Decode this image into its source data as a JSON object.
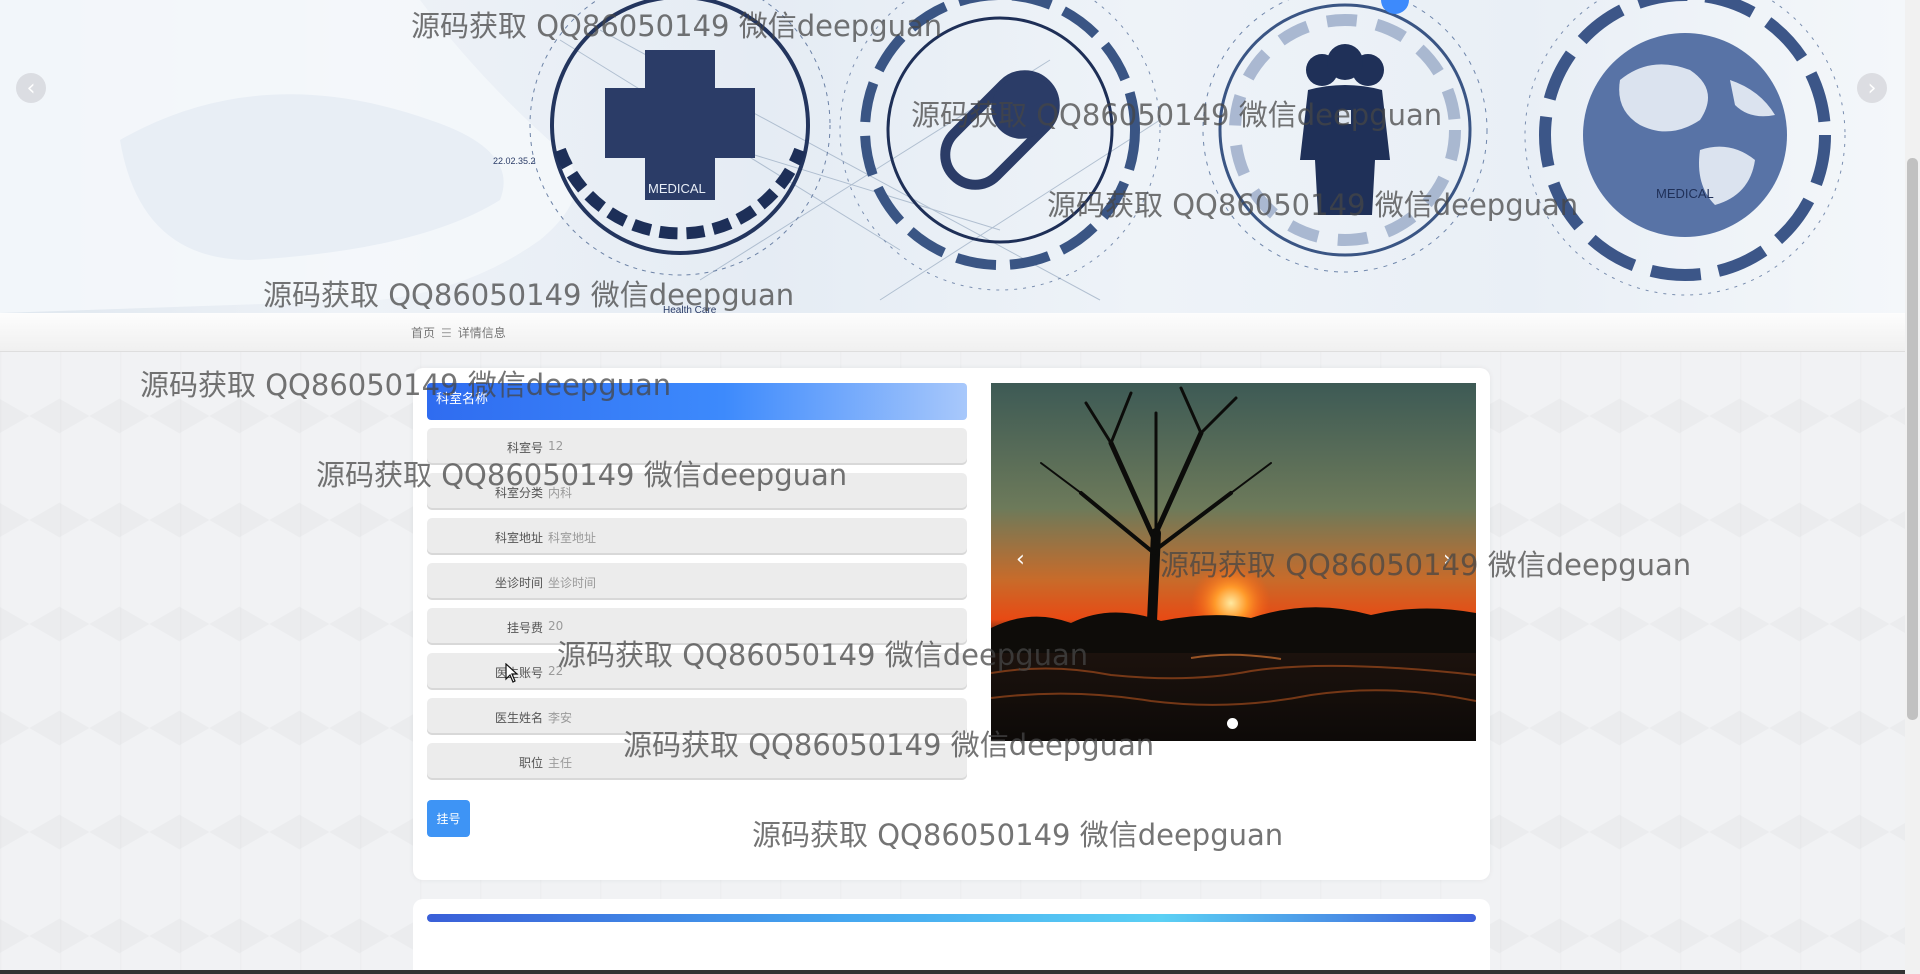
{
  "breadcrumb": {
    "home": "首页",
    "separator": "☰",
    "current": "详情信息"
  },
  "banner": {
    "medical_label_left": "MEDICAL",
    "medical_label_right": "MEDICAL",
    "health_label": "Health Care",
    "code_label": "22.02.35.2",
    "prev_icon": "‹",
    "next_icon": "›"
  },
  "detail": {
    "title": "科室名称",
    "fields": [
      {
        "label": "科室号",
        "value": "12"
      },
      {
        "label": "科室分类",
        "value": "内科"
      },
      {
        "label": "科室地址",
        "value": "科室地址"
      },
      {
        "label": "坐诊时间",
        "value": "坐诊时间"
      },
      {
        "label": "挂号费",
        "value": "20"
      },
      {
        "label": "医生账号",
        "value": "22"
      },
      {
        "label": "医生姓名",
        "value": "李安"
      },
      {
        "label": "职位",
        "value": "主任"
      }
    ],
    "register_button": "挂号",
    "slider_prev": "‹",
    "slider_next": "›"
  },
  "watermark": "源码获取 QQ86050149 微信deepguan",
  "colors": {
    "accent": "#3e94f5",
    "title_gradient_start": "#2f6cf0"
  }
}
